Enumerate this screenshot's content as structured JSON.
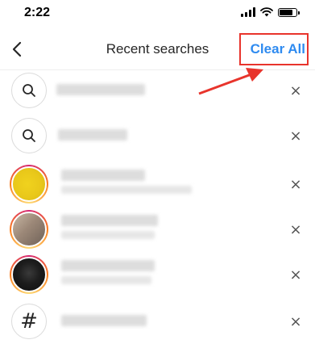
{
  "status_bar": {
    "time": "2:22",
    "battery_level": 0.9
  },
  "nav": {
    "title": "Recent searches",
    "clear_all_label": "Clear All"
  },
  "colors": {
    "accent": "#2f8bf0",
    "annotation": "#e8342c"
  },
  "rows": [
    {
      "kind": "search",
      "icon": "search-icon",
      "remove_label": "×"
    },
    {
      "kind": "search",
      "icon": "search-icon",
      "remove_label": "×"
    },
    {
      "kind": "account",
      "icon": "avatar",
      "remove_label": "×"
    },
    {
      "kind": "account",
      "icon": "avatar",
      "remove_label": "×"
    },
    {
      "kind": "account",
      "icon": "avatar",
      "remove_label": "×"
    },
    {
      "kind": "hashtag",
      "icon": "hashtag-icon",
      "icon_text": "#",
      "remove_label": "×"
    }
  ]
}
